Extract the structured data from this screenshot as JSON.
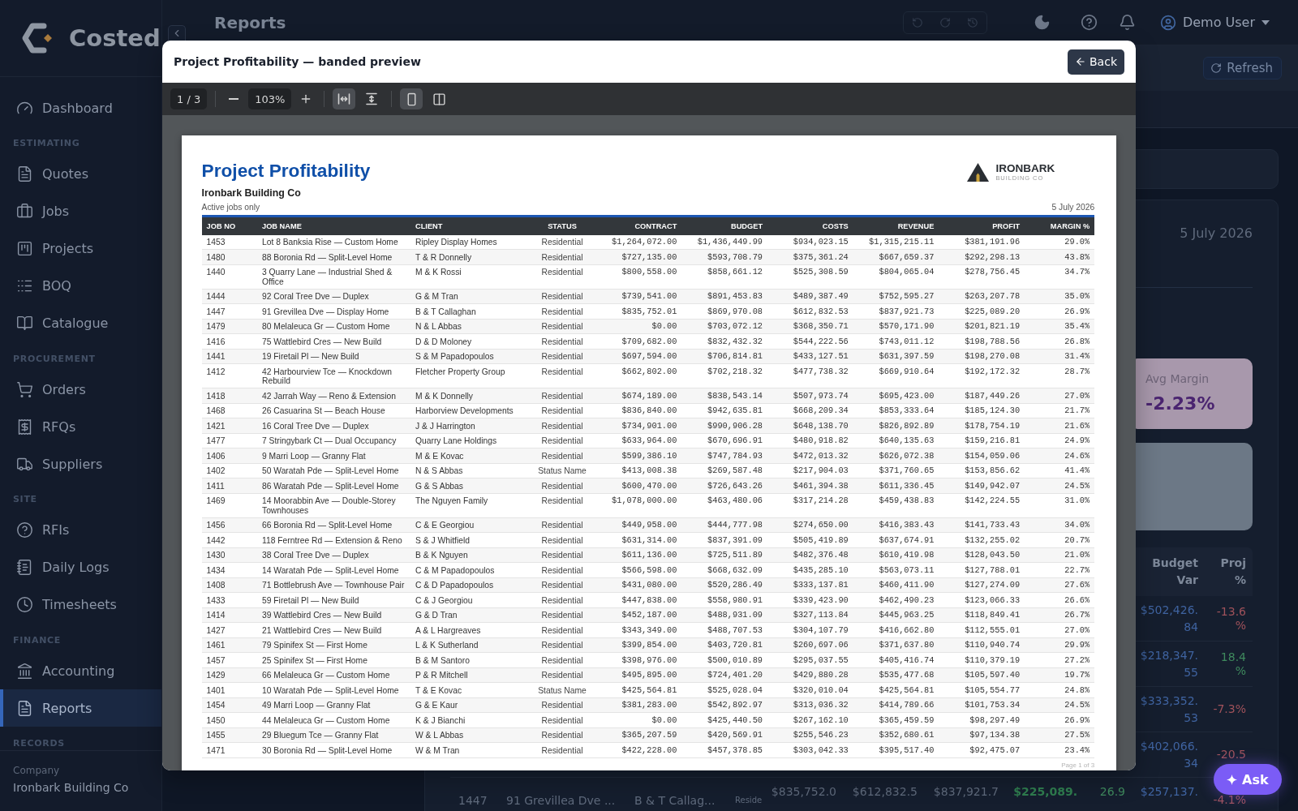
{
  "sidebar": {
    "brand": "Costed",
    "sections": [
      {
        "items": [
          {
            "label": "Dashboard",
            "selected": false
          }
        ]
      },
      {
        "heading": "ESTIMATING",
        "items": [
          {
            "label": "Quotes",
            "selected": false
          },
          {
            "label": "Jobs",
            "selected": false
          },
          {
            "label": "Projects",
            "selected": false
          },
          {
            "label": "BOQ",
            "selected": false
          },
          {
            "label": "Catalogue",
            "selected": false
          }
        ]
      },
      {
        "heading": "PROCUREMENT",
        "items": [
          {
            "label": "Orders",
            "selected": false
          },
          {
            "label": "RFQs",
            "selected": false
          },
          {
            "label": "Suppliers",
            "selected": false
          }
        ]
      },
      {
        "heading": "SITE",
        "items": [
          {
            "label": "RFIs",
            "selected": false
          },
          {
            "label": "Daily Logs",
            "selected": false
          },
          {
            "label": "Timesheets",
            "selected": false
          }
        ]
      },
      {
        "heading": "FINANCE",
        "items": [
          {
            "label": "Accounting",
            "selected": false
          },
          {
            "label": "Reports",
            "selected": true
          }
        ]
      },
      {
        "heading": "RECORDS"
      }
    ],
    "footer": {
      "label": "Company",
      "value": "Ironbark Building Co"
    }
  },
  "header": {
    "title": "Reports",
    "history_buttons": [
      {
        "disabled": true
      },
      {
        "disabled": true
      },
      {
        "disabled": true
      }
    ],
    "user": "Demo User"
  },
  "page": {
    "refresh_button": "Refresh",
    "report_date": "5 July 2026",
    "stat_cards": [
      {
        "label": "Avg Margin",
        "value": "-2.23%"
      }
    ],
    "jobs_table": {
      "headings": {
        "budget_var": "Budget Var",
        "proj": "Proj %"
      },
      "rows": [
        {
          "budget_var": "$502,426.84",
          "proj": {
            "text": "-13.6%",
            "color": "#a0525b"
          }
        },
        {
          "budget_var": "$218,347.55",
          "proj": {
            "text": "18.4%",
            "color": "#3f8a5e"
          }
        },
        {
          "budget_var": "$333,352.53",
          "proj": {
            "text": "-7.3%",
            "color": "#a0525b"
          }
        },
        {
          "budget_var": "$402,066.34",
          "proj": {
            "text": "-20.5",
            "color": "#a0525b"
          }
        },
        {
          "column_1": "1447",
          "column_2": "91 Grevillea Dve ...",
          "column_3": "B & T Callag...",
          "column_4": "Reside",
          "column_5": "$835,752.0",
          "column_6": "$612,832.5",
          "column_7": "$837,921.7",
          "column_8": "$225,089.",
          "column_9": {
            "text": "26.9",
            "color": "#3f8a5e"
          },
          "budget_var": "$257,137.",
          "proj": {
            "text": "-4.1%",
            "color": "#a0525b"
          }
        }
      ]
    }
  },
  "modal": {
    "title": "Project Profitability — banded preview",
    "back_button": "Back",
    "toolbar": {
      "page_indicator": "1 / 3",
      "zoom": "103%",
      "fit_modes": [
        {
          "selected": true
        },
        {
          "selected": false
        }
      ],
      "layouts": [
        {
          "selected": true
        },
        {
          "selected": false
        }
      ]
    },
    "document": {
      "title": "Project Profitability",
      "company": "Ironbark Building Co",
      "subtitle": "Active jobs only",
      "date": "5 July 2026",
      "logo": {
        "name": "IRONBARK",
        "tagline": "BUILDING CO"
      },
      "columns": [
        {
          "label": "JOB NO",
          "kind": "text"
        },
        {
          "label": "JOB NAME",
          "kind": "text"
        },
        {
          "label": "CLIENT",
          "kind": "text"
        },
        {
          "label": "STATUS",
          "kind": "status"
        },
        {
          "label": "CONTRACT",
          "kind": "number"
        },
        {
          "label": "BUDGET",
          "kind": "number"
        },
        {
          "label": "COSTS",
          "kind": "number"
        },
        {
          "label": "REVENUE",
          "kind": "number"
        },
        {
          "label": "PROFIT",
          "kind": "number"
        },
        {
          "label": "MARGIN %",
          "kind": "number"
        }
      ],
      "rows": [
        [
          "1453",
          "Lot 8 Banksia Rise — Custom Home",
          "Ripley Display Homes",
          "Residential",
          "$1,264,072.00",
          "$1,436,449.99",
          "$934,023.15",
          "$1,315,215.11",
          "$381,191.96",
          "29.0%"
        ],
        [
          "1480",
          "88 Boronia Rd — Split-Level Home",
          "T & R Donnelly",
          "Residential",
          "$727,135.00",
          "$593,708.79",
          "$375,361.24",
          "$667,659.37",
          "$292,298.13",
          "43.8%"
        ],
        [
          "1440",
          "3 Quarry Lane — Industrial Shed & Office",
          "M & K Rossi",
          "Residential",
          "$800,558.00",
          "$858,661.12",
          "$525,308.59",
          "$804,065.04",
          "$278,756.45",
          "34.7%"
        ],
        [
          "1444",
          "92 Coral Tree Dve — Duplex",
          "G & M Tran",
          "Residential",
          "$739,541.00",
          "$891,453.83",
          "$489,387.49",
          "$752,595.27",
          "$263,207.78",
          "35.0%"
        ],
        [
          "1447",
          "91 Grevillea Dve — Display Home",
          "B & T Callaghan",
          "Residential",
          "$835,752.01",
          "$869,970.08",
          "$612,832.53",
          "$837,921.73",
          "$225,089.20",
          "26.9%"
        ],
        [
          "1479",
          "80 Melaleuca Gr — Custom Home",
          "N & L Abbas",
          "Residential",
          "$0.00",
          "$703,072.12",
          "$368,350.71",
          "$570,171.90",
          "$201,821.19",
          "35.4%"
        ],
        [
          "1416",
          "75 Wattlebird Cres — New Build",
          "D & D Moloney",
          "Residential",
          "$709,682.00",
          "$832,432.32",
          "$544,222.56",
          "$743,011.12",
          "$198,788.56",
          "26.8%"
        ],
        [
          "1441",
          "19 Firetail Pl — New Build",
          "S & M Papadopoulos",
          "Residential",
          "$697,594.00",
          "$706,814.81",
          "$433,127.51",
          "$631,397.59",
          "$198,270.08",
          "31.4%"
        ],
        [
          "1412",
          "42 Harbourview Tce — Knockdown Rebuild",
          "Fletcher Property Group",
          "Residential",
          "$662,802.00",
          "$702,218.32",
          "$477,738.32",
          "$669,910.64",
          "$192,172.32",
          "28.7%"
        ],
        [
          "1418",
          "42 Jarrah Way — Reno & Extension",
          "M & K Donnelly",
          "Residential",
          "$674,189.00",
          "$838,543.14",
          "$507,973.74",
          "$695,423.00",
          "$187,449.26",
          "27.0%"
        ],
        [
          "1468",
          "26 Casuarina St — Beach House",
          "Harborview Developments",
          "Residential",
          "$836,840.00",
          "$942,635.81",
          "$668,209.34",
          "$853,333.64",
          "$185,124.30",
          "21.7%"
        ],
        [
          "1421",
          "16 Coral Tree Dve — Duplex",
          "J & J Harrington",
          "Residential",
          "$734,901.00",
          "$990,906.28",
          "$648,138.70",
          "$826,892.89",
          "$178,754.19",
          "21.6%"
        ],
        [
          "1477",
          "7 Stringybark Ct — Dual Occupancy",
          "Quarry Lane Holdings",
          "Residential",
          "$633,964.00",
          "$670,696.91",
          "$480,918.82",
          "$640,135.63",
          "$159,216.81",
          "24.9%"
        ],
        [
          "1406",
          "9 Marri Loop — Granny Flat",
          "M & E Kovac",
          "Residential",
          "$599,386.10",
          "$747,784.93",
          "$472,013.32",
          "$626,072.38",
          "$154,059.06",
          "24.6%"
        ],
        [
          "1402",
          "50 Waratah Pde — Split-Level Home",
          "N & S Abbas",
          "Status Name",
          "$413,008.38",
          "$269,587.48",
          "$217,904.03",
          "$371,760.65",
          "$153,856.62",
          "41.4%"
        ],
        [
          "1411",
          "86 Waratah Pde — Split-Level Home",
          "G & S Abbas",
          "Residential",
          "$600,470.00",
          "$726,643.26",
          "$461,394.38",
          "$611,336.45",
          "$149,942.07",
          "24.5%"
        ],
        [
          "1469",
          "14 Moorabbin Ave — Double-Storey Townhouses",
          "The Nguyen Family",
          "Residential",
          "$1,078,000.00",
          "$463,480.06",
          "$317,214.28",
          "$459,438.83",
          "$142,224.55",
          "31.0%"
        ],
        [
          "1456",
          "66 Boronia Rd — Split-Level Home",
          "C & E Georgiou",
          "Residential",
          "$449,958.00",
          "$444,777.98",
          "$274,650.00",
          "$416,383.43",
          "$141,733.43",
          "34.0%"
        ],
        [
          "1442",
          "118 Ferntree Rd — Extension & Reno",
          "S & J Whitfield",
          "Residential",
          "$631,314.00",
          "$837,391.09",
          "$505,419.89",
          "$637,674.91",
          "$132,255.02",
          "20.7%"
        ],
        [
          "1430",
          "38 Coral Tree Dve — Duplex",
          "B & K Nguyen",
          "Residential",
          "$611,136.00",
          "$725,511.89",
          "$482,376.48",
          "$610,419.98",
          "$128,043.50",
          "21.0%"
        ],
        [
          "1434",
          "14 Waratah Pde — Split-Level Home",
          "C & M Papadopoulos",
          "Residential",
          "$566,598.00",
          "$668,632.09",
          "$435,285.10",
          "$563,073.11",
          "$127,788.01",
          "22.7%"
        ],
        [
          "1408",
          "71 Bottlebrush Ave — Townhouse Pair",
          "C & D Papadopoulos",
          "Residential",
          "$431,080.00",
          "$520,286.49",
          "$333,137.81",
          "$460,411.90",
          "$127,274.09",
          "27.6%"
        ],
        [
          "1433",
          "59 Firetail Pl — New Build",
          "C & J Georgiou",
          "Residential",
          "$447,838.00",
          "$558,980.91",
          "$339,423.90",
          "$462,490.23",
          "$123,066.33",
          "26.6%"
        ],
        [
          "1414",
          "39 Wattlebird Cres — New Build",
          "G & D Tran",
          "Residential",
          "$452,187.00",
          "$488,931.09",
          "$327,113.84",
          "$445,963.25",
          "$118,849.41",
          "26.7%"
        ],
        [
          "1427",
          "21 Wattlebird Cres — New Build",
          "A & L Hargreaves",
          "Residential",
          "$343,349.00",
          "$488,707.53",
          "$304,107.79",
          "$416,662.80",
          "$112,555.01",
          "27.0%"
        ],
        [
          "1461",
          "79 Spinifex St — First Home",
          "L & K Sutherland",
          "Residential",
          "$399,854.00",
          "$403,720.81",
          "$260,697.06",
          "$371,637.80",
          "$110,940.74",
          "29.9%"
        ],
        [
          "1457",
          "25 Spinifex St — First Home",
          "B & M Santoro",
          "Residential",
          "$398,976.00",
          "$500,010.89",
          "$295,037.55",
          "$405,416.74",
          "$110,379.19",
          "27.2%"
        ],
        [
          "1429",
          "66 Melaleuca Gr — Custom Home",
          "P & R Mitchell",
          "Residential",
          "$495,895.00",
          "$724,401.20",
          "$429,880.28",
          "$535,477.68",
          "$105,597.40",
          "19.7%"
        ],
        [
          "1401",
          "10 Waratah Pde — Split-Level Home",
          "T & E Kovac",
          "Status Name",
          "$425,564.81",
          "$525,028.04",
          "$320,010.04",
          "$425,564.81",
          "$105,554.77",
          "24.8%"
        ],
        [
          "1454",
          "49 Marri Loop — Granny Flat",
          "G & E Kaur",
          "Residential",
          "$381,283.00",
          "$542,892.97",
          "$313,036.32",
          "$414,789.66",
          "$101,753.34",
          "24.5%"
        ],
        [
          "1450",
          "44 Melaleuca Gr — Custom Home",
          "K & J Bianchi",
          "Residential",
          "$0.00",
          "$425,440.50",
          "$267,162.10",
          "$365,459.59",
          "$98,297.49",
          "26.9%"
        ],
        [
          "1455",
          "29 Bluegum Tce — Granny Flat",
          "W & L Abbas",
          "Residential",
          "$365,207.59",
          "$420,569.91",
          "$255,546.23",
          "$352,680.61",
          "$97,134.38",
          "27.5%"
        ],
        [
          "1471",
          "30 Boronia Rd — Split-Level Home",
          "W & M Tran",
          "Residential",
          "$422,228.00",
          "$457,378.85",
          "$303,042.33",
          "$395,517.40",
          "$92,475.07",
          "23.4%"
        ]
      ],
      "footer": "Page 1 of 3"
    }
  },
  "ask_button": "Ask"
}
